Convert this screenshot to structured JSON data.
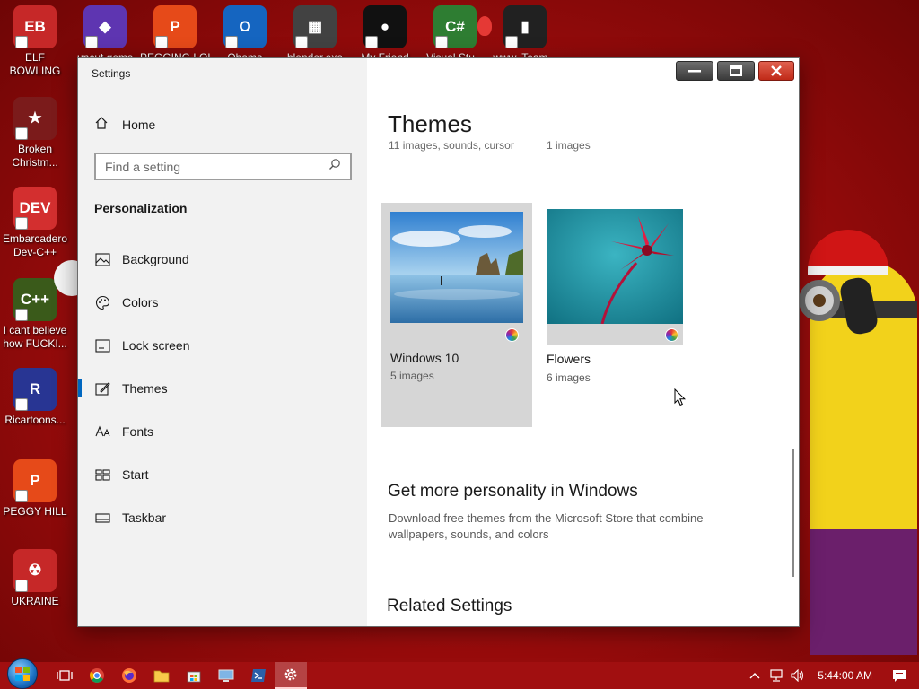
{
  "desktop": {
    "icons": [
      {
        "label": "ELF BOWLING",
        "color": "#c62828",
        "glyph": "EB"
      },
      {
        "label": "Broken Christm...",
        "color": "#7b1b1b",
        "glyph": "★"
      },
      {
        "label": "Embarcadero Dev-C++",
        "color": "#d32f2f",
        "glyph": "DEV"
      },
      {
        "label": "I cant believe how FUCKI...",
        "color": "#3a5a1a",
        "glyph": "C++"
      },
      {
        "label": "Ricartoons...",
        "color": "#283593",
        "glyph": "R"
      },
      {
        "label": "PEGGY HILL",
        "color": "#e64a19",
        "glyph": "P"
      },
      {
        "label": "UKRAINE",
        "color": "#c62828",
        "glyph": "☢"
      }
    ],
    "top_icons": [
      {
        "label": "uncut gems",
        "color": "#5e35b1",
        "glyph": "◆"
      },
      {
        "label": "PEGGING LOL",
        "color": "#e64a19",
        "glyph": "P"
      },
      {
        "label": "Obama",
        "color": "#1565c0",
        "glyph": "O"
      },
      {
        "label": "blender.exe",
        "color": "#424242",
        "glyph": "▦"
      },
      {
        "label": "My Friend",
        "color": "#111111",
        "glyph": "●"
      },
      {
        "label": "Visual Stu...",
        "color": "#2e7d32",
        "glyph": "C#"
      },
      {
        "label": "www. Team...",
        "color": "#212121",
        "glyph": "▮"
      }
    ]
  },
  "window": {
    "title": "Settings",
    "sidebar": {
      "home_label": "Home",
      "search_placeholder": "Find a setting",
      "section": "Personalization",
      "items": [
        {
          "label": "Background",
          "icon": "background-icon"
        },
        {
          "label": "Colors",
          "icon": "palette-icon"
        },
        {
          "label": "Lock screen",
          "icon": "lock-screen-icon"
        },
        {
          "label": "Themes",
          "icon": "themes-icon"
        },
        {
          "label": "Fonts",
          "icon": "fonts-icon"
        },
        {
          "label": "Start",
          "icon": "start-icon"
        },
        {
          "label": "Taskbar",
          "icon": "taskbar-icon"
        }
      ],
      "active_item": "Themes"
    },
    "content": {
      "page_title": "Themes",
      "prev_row": [
        "11 images, sounds, cursor",
        "1 images"
      ],
      "themes": [
        {
          "name": "Windows 10",
          "count": "5 images"
        },
        {
          "name": "Flowers",
          "count": "6 images"
        }
      ],
      "more_title": "Get more personality in Windows",
      "more_desc": "Download free themes from the Microsoft Store that combine wallpapers, sounds, and colors",
      "related_title": "Related Settings"
    }
  },
  "taskbar": {
    "clock": "5:44:00 AM",
    "accent": "#a10f10"
  }
}
